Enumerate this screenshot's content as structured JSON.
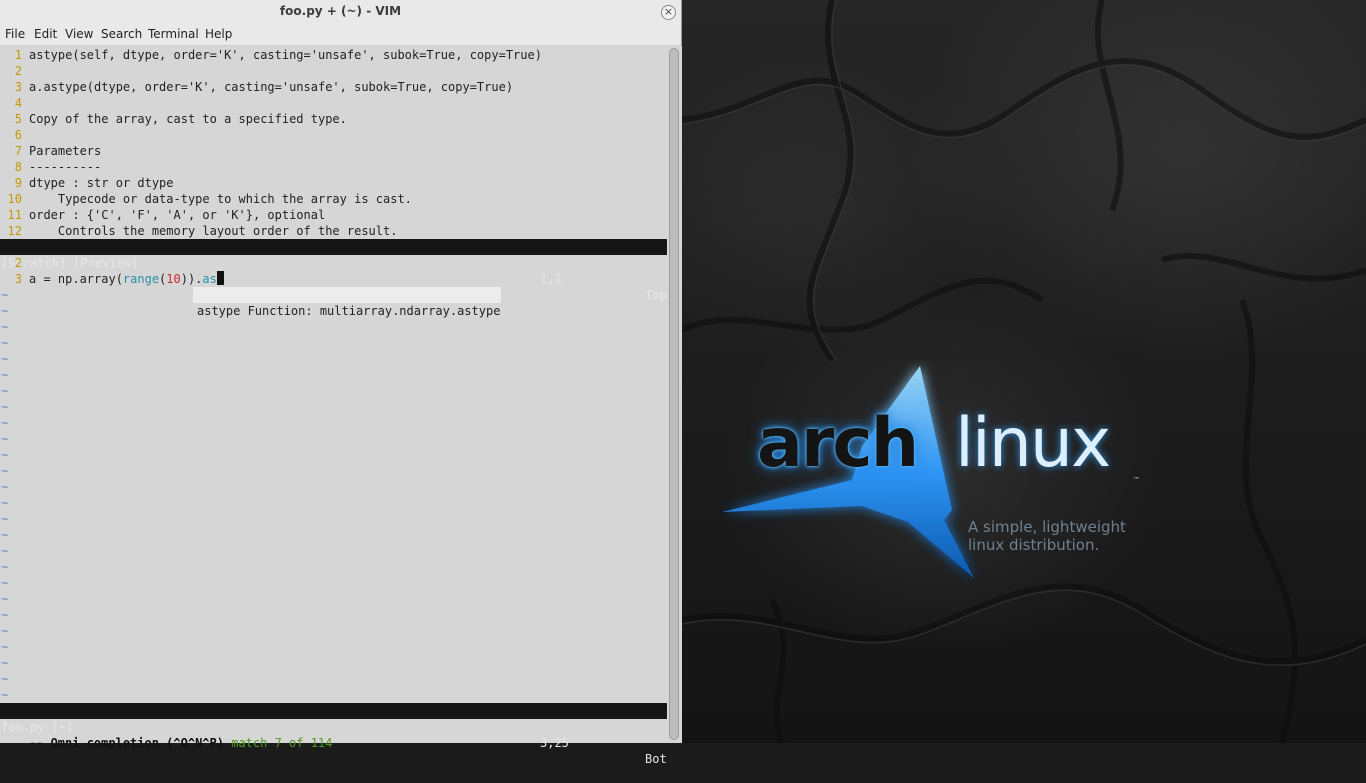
{
  "window": {
    "title": "foo.py + (~) - VIM",
    "close_symbol": "×"
  },
  "menu": [
    "File",
    "Edit",
    "View",
    "Search",
    "Terminal",
    "Help"
  ],
  "preview": {
    "lines": [
      {
        "n": "1",
        "text": "astype(self, dtype, order='K', casting='unsafe', subok=True, copy=True)"
      },
      {
        "n": "2",
        "text": ""
      },
      {
        "n": "3",
        "text": "a.astype(dtype, order='K', casting='unsafe', subok=True, copy=True)"
      },
      {
        "n": "4",
        "text": ""
      },
      {
        "n": "5",
        "text": "Copy of the array, cast to a specified type."
      },
      {
        "n": "6",
        "text": ""
      },
      {
        "n": "7",
        "text": "Parameters"
      },
      {
        "n": "8",
        "text": "----------"
      },
      {
        "n": "9",
        "text": "dtype : str or dtype"
      },
      {
        "n": "10",
        "text": "    Typecode or data-type to which the array is cast."
      },
      {
        "n": "11",
        "text": "order : {'C', 'F', 'A', or 'K'}, optional"
      },
      {
        "n": "12",
        "text": "    Controls the memory layout order of the result."
      }
    ],
    "status": {
      "name": "[Scratch] [Preview]",
      "position": "1,1",
      "scroll": "Top"
    }
  },
  "buffer": {
    "line2": {
      "n": "2",
      "text": ""
    },
    "line3": {
      "n": "3",
      "prefix": "a = np.array(",
      "builtin": "range",
      "open": "(",
      "number": "10",
      "close": ")).",
      "typed": "as"
    },
    "tilde": "~",
    "status": {
      "name": "foo.py [+]",
      "position": "3,25",
      "scroll": "Bot"
    }
  },
  "completion": {
    "text": "astype Function: multiarray.ndarray.astype"
  },
  "cmdline": {
    "mode": "-- Omni completion (^O^N^P)",
    "match": "match 7 of 114"
  },
  "wallpaper": {
    "logo_word_1": "arch",
    "logo_word_2": "linux",
    "trademark": "™",
    "tagline": "A simple, lightweight\nlinux distribution.",
    "accent_color": "#2f9bff"
  }
}
